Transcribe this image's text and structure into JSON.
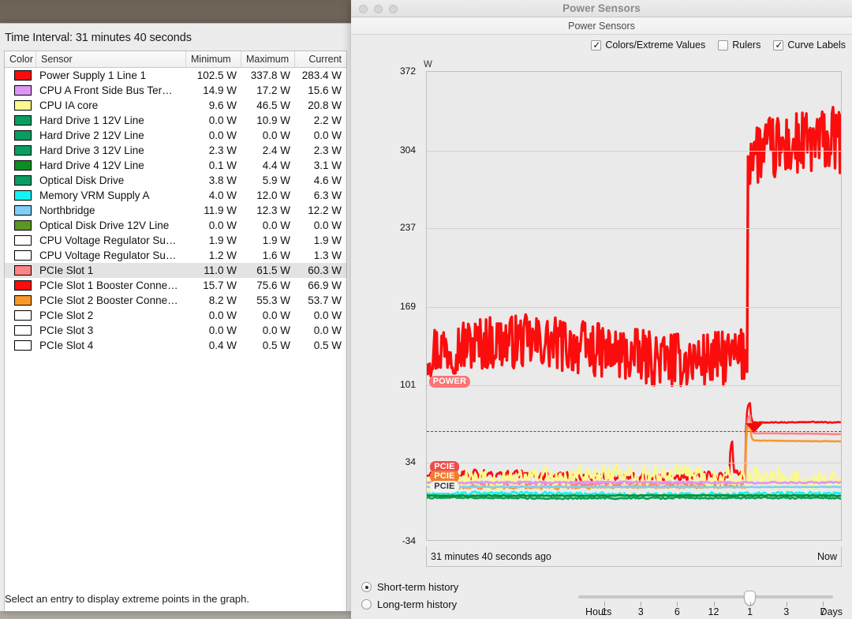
{
  "left_window": {
    "time_interval_label": "Time Interval: 31 minutes 40 seconds",
    "hint": "Select an entry to display extreme points in the graph.",
    "columns": [
      "Color",
      "Sensor",
      "Minimum",
      "Maximum",
      "Current"
    ],
    "rows": [
      {
        "color": "#fb0d0d",
        "sensor": "Power Supply 1 Line 1",
        "min": "102.5 W",
        "max": "337.8 W",
        "cur": "283.4 W",
        "selected": false
      },
      {
        "color": "#dd96f4",
        "sensor": "CPU A Front Side Bus Ter…",
        "min": "14.9 W",
        "max": "17.2 W",
        "cur": "15.6 W",
        "selected": false
      },
      {
        "color": "#fbf98f",
        "sensor": "CPU IA core",
        "min": "9.6 W",
        "max": "46.5 W",
        "cur": "20.8 W",
        "selected": false
      },
      {
        "color": "#0a9d62",
        "sensor": "Hard Drive 1 12V Line",
        "min": "0.0 W",
        "max": "10.9 W",
        "cur": "2.2 W",
        "selected": false
      },
      {
        "color": "#0a9d62",
        "sensor": "Hard Drive 2 12V Line",
        "min": "0.0 W",
        "max": "0.0 W",
        "cur": "0.0 W",
        "selected": false
      },
      {
        "color": "#0a9d62",
        "sensor": "Hard Drive 3 12V Line",
        "min": "2.3 W",
        "max": "2.4 W",
        "cur": "2.3 W",
        "selected": false
      },
      {
        "color": "#0a8f22",
        "sensor": "Hard Drive 4 12V Line",
        "min": "0.1 W",
        "max": "4.4 W",
        "cur": "3.1 W",
        "selected": false
      },
      {
        "color": "#0a9d62",
        "sensor": "Optical Disk Drive",
        "min": "3.8 W",
        "max": "5.9 W",
        "cur": "4.6 W",
        "selected": false
      },
      {
        "color": "#11f5f5",
        "sensor": "Memory VRM Supply A",
        "min": "4.0 W",
        "max": "12.0 W",
        "cur": "6.3 W",
        "selected": false
      },
      {
        "color": "#80cdf7",
        "sensor": "Northbridge",
        "min": "11.9 W",
        "max": "12.3 W",
        "cur": "12.2 W",
        "selected": false
      },
      {
        "color": "#5a9622",
        "sensor": "Optical Disk Drive 12V Line",
        "min": "0.0 W",
        "max": "0.0 W",
        "cur": "0.0 W",
        "selected": false
      },
      {
        "color": "#ffffff",
        "sensor": "CPU Voltage Regulator Su…",
        "min": "1.9 W",
        "max": "1.9 W",
        "cur": "1.9 W",
        "selected": false
      },
      {
        "color": "#ffffff",
        "sensor": "CPU Voltage Regulator Su…",
        "min": "1.2 W",
        "max": "1.6 W",
        "cur": "1.3 W",
        "selected": false
      },
      {
        "color": "#fb8484",
        "sensor": "PCIe Slot 1",
        "min": "11.0 W",
        "max": "61.5 W",
        "cur": "60.3 W",
        "selected": true
      },
      {
        "color": "#fb0d0d",
        "sensor": "PCIe Slot 1 Booster Conne…",
        "min": "15.7 W",
        "max": "75.6 W",
        "cur": "66.9 W",
        "selected": false
      },
      {
        "color": "#f79a2a",
        "sensor": "PCIe Slot 2 Booster Conne…",
        "min": "8.2 W",
        "max": "55.3 W",
        "cur": "53.7 W",
        "selected": false
      },
      {
        "color": "#ffffff",
        "sensor": "PCIe Slot 2",
        "min": "0.0 W",
        "max": "0.0 W",
        "cur": "0.0 W",
        "selected": false
      },
      {
        "color": "#ffffff",
        "sensor": "PCIe Slot 3",
        "min": "0.0 W",
        "max": "0.0 W",
        "cur": "0.0 W",
        "selected": false
      },
      {
        "color": "#ffffff",
        "sensor": "PCIe Slot 4",
        "min": "0.4 W",
        "max": "0.5 W",
        "cur": "0.5 W",
        "selected": false
      }
    ]
  },
  "power_window": {
    "title": "Power Sensors",
    "subheader": "Power Sensors",
    "options": [
      {
        "label": "Colors/Extreme Values",
        "checked": true
      },
      {
        "label": "Rulers",
        "checked": false
      },
      {
        "label": "Curve Labels",
        "checked": true
      }
    ],
    "time_axis": {
      "start": "31 minutes 40 seconds ago",
      "end": "Now"
    },
    "history_modes": [
      {
        "label": "Short-term history",
        "selected": true
      },
      {
        "label": "Long-term history",
        "selected": false
      }
    ],
    "slider": {
      "hours_label": "Hours",
      "days_label": "Days",
      "ticks": [
        "1",
        "3",
        "6",
        "12",
        "1",
        "3",
        "7"
      ],
      "value_index": 4
    }
  },
  "chart_data": {
    "type": "line",
    "title": "Power Sensors",
    "xlabel": "",
    "ylabel": "W",
    "unit": "W",
    "ylim": [
      -34,
      372
    ],
    "yticks": [
      372,
      304,
      237,
      169,
      101,
      34,
      -34
    ],
    "grid": true,
    "legend": "none",
    "x_start_label": "31 minutes 40 seconds ago",
    "x_end_label": "Now",
    "extreme_line_value": 61.5,
    "annotations": [
      {
        "text": "POWER",
        "color": "#fb7575",
        "value": 104
      },
      {
        "text": "PCIE",
        "color": "#ef4b4b",
        "value": 30
      },
      {
        "text": "PCIE",
        "color": "#f47b2e",
        "value": 22
      },
      {
        "text": "PCIE",
        "color": "#f2f2f2",
        "value": 13
      }
    ],
    "series": [
      {
        "name": "Power Supply 1 Line 1",
        "color": "#fb0d0d",
        "min": 102.5,
        "max": 337.8,
        "current": 283.4,
        "baseline": 130,
        "step_at": 0.775,
        "step_level": 305,
        "noise": 28
      },
      {
        "name": "PCIe Slot 1 Booster Connector",
        "color": "#fb0d0d",
        "min": 15.7,
        "max": 75.6,
        "current": 66.9,
        "baseline": 22,
        "step_at": 0.775,
        "step_level": 67,
        "noise": 5
      },
      {
        "name": "PCIe Slot 1",
        "color": "#fb8484",
        "min": 11.0,
        "max": 61.5,
        "current": 60.3,
        "baseline": 15,
        "step_at": 0.775,
        "step_level": 58,
        "noise": 2
      },
      {
        "name": "PCIe Slot 2 Booster Connector",
        "color": "#f79a2a",
        "min": 8.2,
        "max": 55.3,
        "current": 53.7,
        "baseline": 12,
        "step_at": 0.775,
        "step_level": 52,
        "noise": 2
      },
      {
        "name": "CPU IA core",
        "color": "#fbf98f",
        "min": 9.6,
        "max": 46.5,
        "current": 20.8,
        "baseline": 20,
        "step_at": 0.775,
        "step_level": 22,
        "noise": 12
      },
      {
        "name": "CPU A Front Side Bus Termination",
        "color": "#dd96f4",
        "min": 14.9,
        "max": 17.2,
        "current": 15.6,
        "baseline": 16,
        "step_at": 0.775,
        "step_level": 16,
        "noise": 1
      },
      {
        "name": "Northbridge",
        "color": "#80cdf7",
        "min": 11.9,
        "max": 12.3,
        "current": 12.2,
        "baseline": 12,
        "step_at": 0.775,
        "step_level": 12,
        "noise": 0.4
      },
      {
        "name": "Memory VRM Supply A",
        "color": "#11f5f5",
        "min": 4.0,
        "max": 12.0,
        "current": 6.3,
        "baseline": 6,
        "step_at": 0.775,
        "step_level": 6,
        "noise": 2
      },
      {
        "name": "Hard Drive 1 12V Line",
        "color": "#0a9d62",
        "min": 0.0,
        "max": 10.9,
        "current": 2.2,
        "baseline": 2.5,
        "step_at": 0.775,
        "step_level": 2.5,
        "noise": 1
      },
      {
        "name": "Optical Disk Drive",
        "color": "#0a8f22",
        "min": 3.8,
        "max": 5.9,
        "current": 4.6,
        "baseline": 4.6,
        "step_at": 0.775,
        "step_level": 4.6,
        "noise": 0.5
      }
    ]
  }
}
